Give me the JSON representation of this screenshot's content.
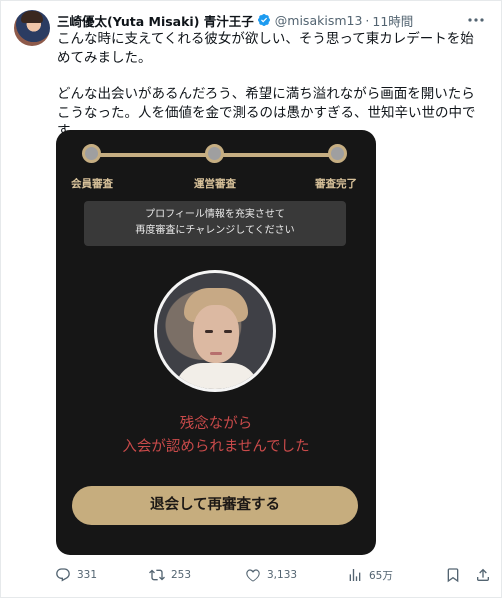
{
  "tweet": {
    "author_name": "三崎優太(Yuta Misaki) 青汁王子",
    "handle": "@misakism13",
    "time": "11時間",
    "text_para1": "こんな時に支えてくれる彼女が欲しい、そう思って東カレデートを始めてみました。",
    "text_para2": "どんな出会いがあるんだろう、希望に満ち溢れながら画面を開いたらこうなった。人を価値を金で測るのは愚かすぎる、世知辛い世の中です。"
  },
  "media": {
    "steps": [
      "会員審査",
      "運営審査",
      "審査完了"
    ],
    "notice_line1": "プロフィール情報を充実させて",
    "notice_line2": "再度審査にチャレンジしてください",
    "reject_line1": "残念ながら",
    "reject_line2": "入会が認められませんでした",
    "button_label": "退会して再審査する"
  },
  "actions": {
    "replies": "331",
    "retweets": "253",
    "likes": "3,133",
    "views": "65万"
  },
  "colors": {
    "verified": "#1d9bf0",
    "media_bg": "#161616",
    "gold": "#c6ad7e",
    "reject_red": "#c94a4a"
  },
  "icons": [
    "verified-badge-icon",
    "more-icon",
    "reply-icon",
    "retweet-icon",
    "like-icon",
    "views-icon",
    "bookmark-icon",
    "share-icon"
  ]
}
